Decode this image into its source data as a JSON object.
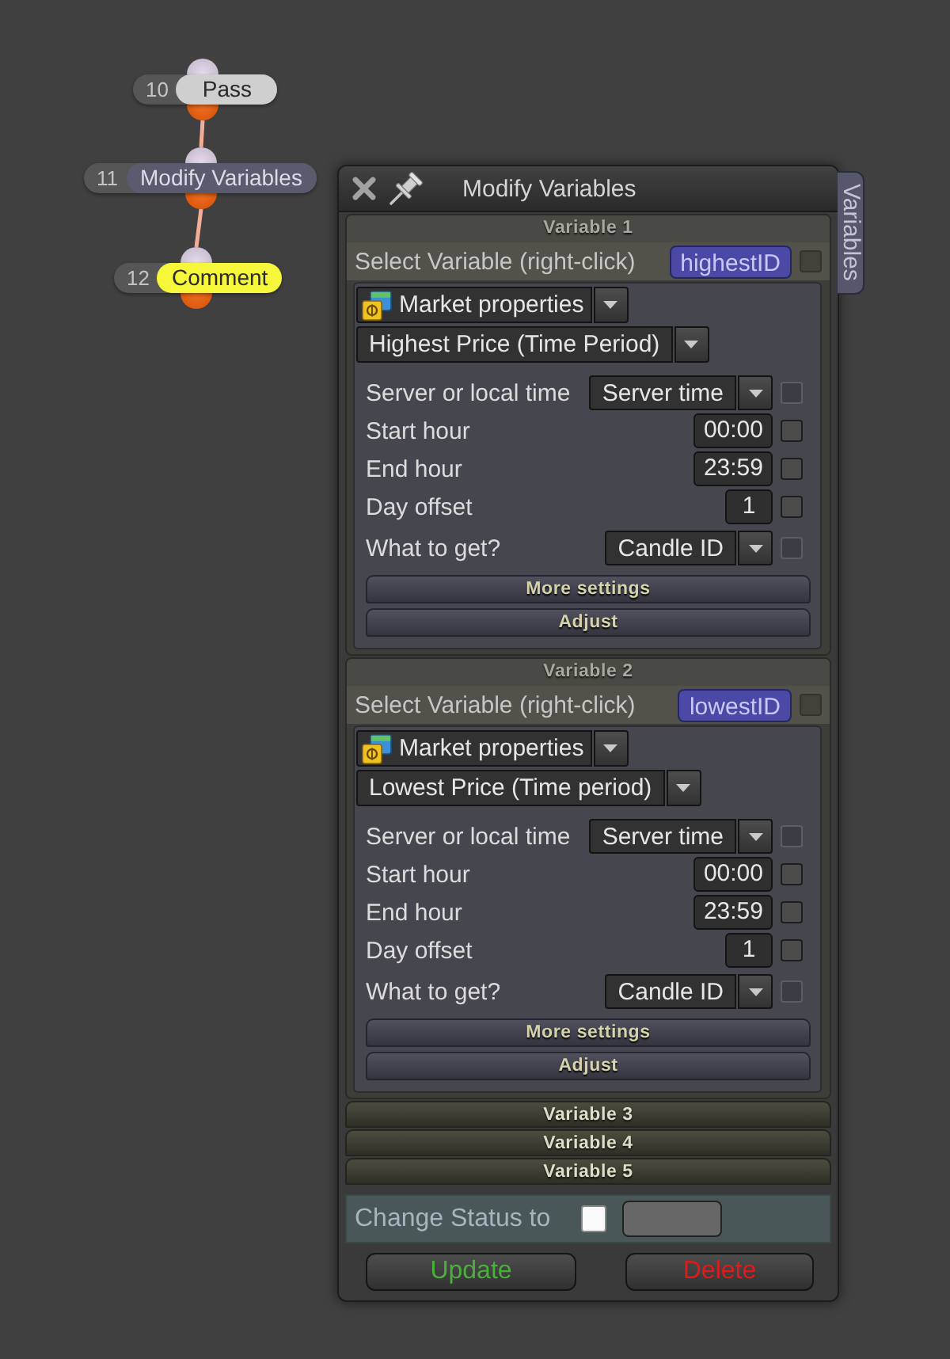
{
  "canvas": {
    "nodes": [
      {
        "number": "10",
        "label": "Pass",
        "color": "#cfcfcf"
      },
      {
        "number": "11",
        "label": "Modify Variables",
        "color": "#5b5b70"
      },
      {
        "number": "12",
        "label": "Comment",
        "color": "#f6f63a"
      }
    ]
  },
  "panel": {
    "title": "Modify Variables",
    "side_tab": "Variables",
    "sections": [
      {
        "title": "Variable 1",
        "expanded": true,
        "select_label": "Select Variable (right-click)",
        "variable": "highestID",
        "variable_checkbox": {
          "checked": false,
          "disabled": true
        },
        "category": "Market properties",
        "function": "Highest Price (Time Period)",
        "fields": [
          {
            "kind": "dropdown",
            "label": "Server or local time",
            "value": "Server time",
            "checkbox": {
              "checked": false,
              "disabled": true
            }
          },
          {
            "kind": "input",
            "label": "Start hour",
            "value": "00:00",
            "checkbox": {
              "checked": false,
              "disabled": false
            }
          },
          {
            "kind": "input",
            "label": "End hour",
            "value": "23:59",
            "checkbox": {
              "checked": false,
              "disabled": false
            }
          },
          {
            "kind": "input",
            "label": "Day offset",
            "value": "1",
            "checkbox": {
              "checked": false,
              "disabled": false
            }
          },
          {
            "kind": "dropdown",
            "label": "What to get?",
            "value": "Candle ID",
            "checkbox": {
              "checked": false,
              "disabled": true
            }
          }
        ],
        "buttons": [
          "More settings",
          "Adjust"
        ]
      },
      {
        "title": "Variable 2",
        "expanded": true,
        "select_label": "Select Variable (right-click)",
        "variable": "lowestID",
        "variable_checkbox": {
          "checked": false,
          "disabled": true
        },
        "category": "Market properties",
        "function": "Lowest Price (Time period)",
        "fields": [
          {
            "kind": "dropdown",
            "label": "Server or local time",
            "value": "Server time",
            "checkbox": {
              "checked": false,
              "disabled": true
            }
          },
          {
            "kind": "input",
            "label": "Start hour",
            "value": "00:00",
            "checkbox": {
              "checked": false,
              "disabled": false
            }
          },
          {
            "kind": "input",
            "label": "End hour",
            "value": "23:59",
            "checkbox": {
              "checked": false,
              "disabled": false
            }
          },
          {
            "kind": "input",
            "label": "Day offset",
            "value": "1",
            "checkbox": {
              "checked": false,
              "disabled": false
            }
          },
          {
            "kind": "dropdown",
            "label": "What to get?",
            "value": "Candle ID",
            "checkbox": {
              "checked": false,
              "disabled": true
            }
          }
        ],
        "buttons": [
          "More settings",
          "Adjust"
        ]
      },
      {
        "title": "Variable 3",
        "expanded": false
      },
      {
        "title": "Variable 4",
        "expanded": false
      },
      {
        "title": "Variable 5",
        "expanded": false
      }
    ],
    "status": {
      "label": "Change Status to",
      "checked": false
    },
    "buttons": [
      {
        "label": "Update",
        "color": "#4cae3c"
      },
      {
        "label": "Delete",
        "color": "#e01a1a"
      }
    ]
  }
}
